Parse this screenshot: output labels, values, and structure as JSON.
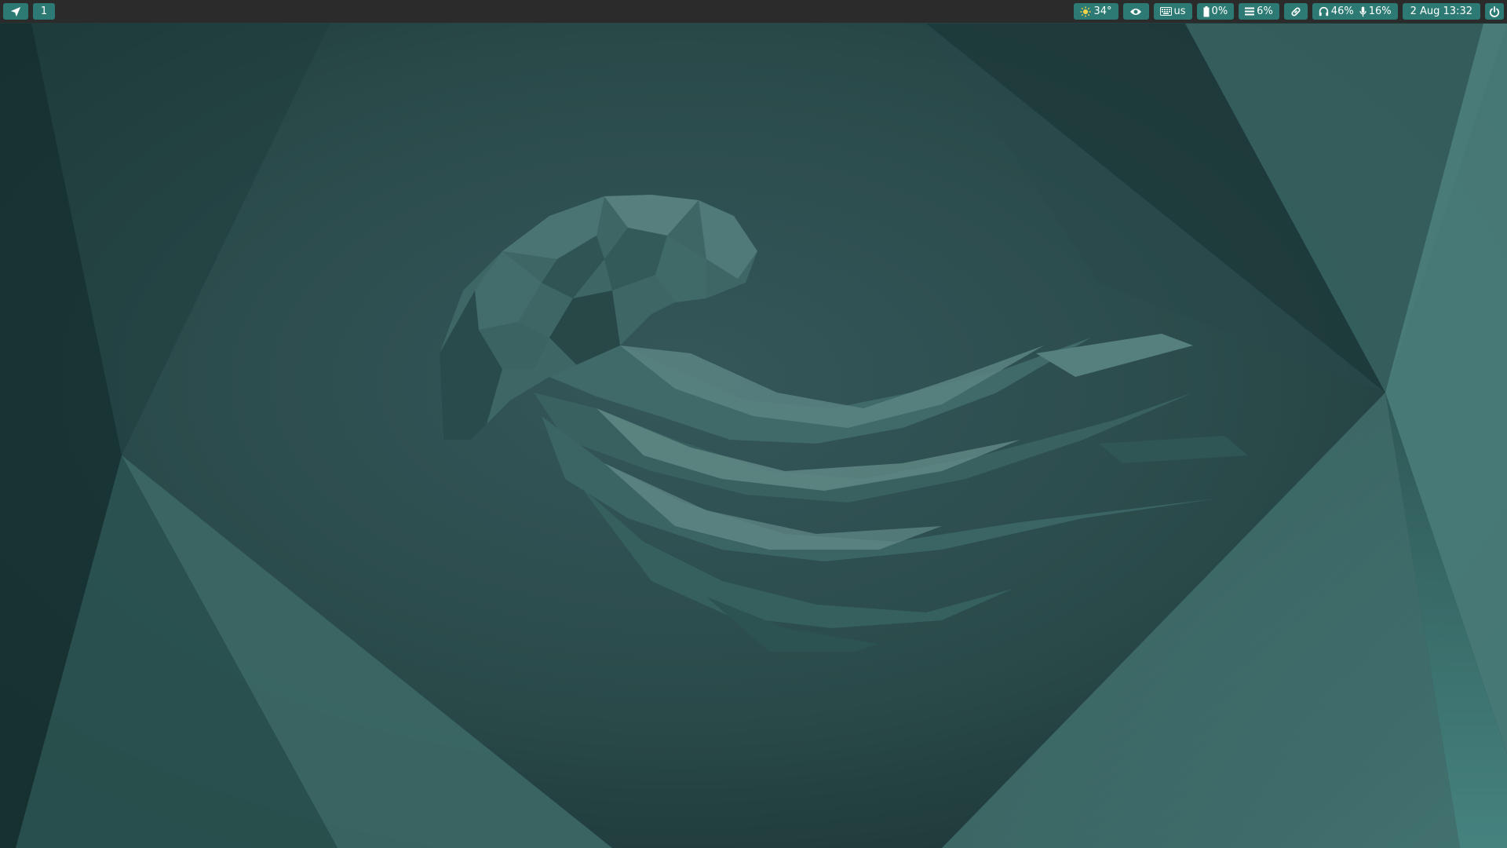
{
  "topbar": {
    "workspace": "1",
    "weather": {
      "icon": "sun-icon",
      "value": "34°"
    },
    "redshift": {
      "icon": "eye-icon"
    },
    "keyboard": {
      "icon": "keyboard-icon",
      "layout": "us"
    },
    "battery": {
      "icon": "battery-icon",
      "value": "0%"
    },
    "memory": {
      "icon": "list-icon",
      "value": "6%"
    },
    "network": {
      "icon": "link-icon"
    },
    "audio": {
      "icon": "headphones-icon",
      "volume": "46%",
      "mic_icon": "microphone-icon",
      "mic": "16%"
    },
    "clock": "2 Aug 13:32",
    "power": {
      "icon": "power-icon"
    }
  },
  "colors": {
    "bar_background": "#2b2b2b",
    "pill_accent": "#2c7a73",
    "wallpaper_base": "#2b4a48"
  },
  "wallpaper": {
    "subject": "low-poly jellyfish"
  }
}
